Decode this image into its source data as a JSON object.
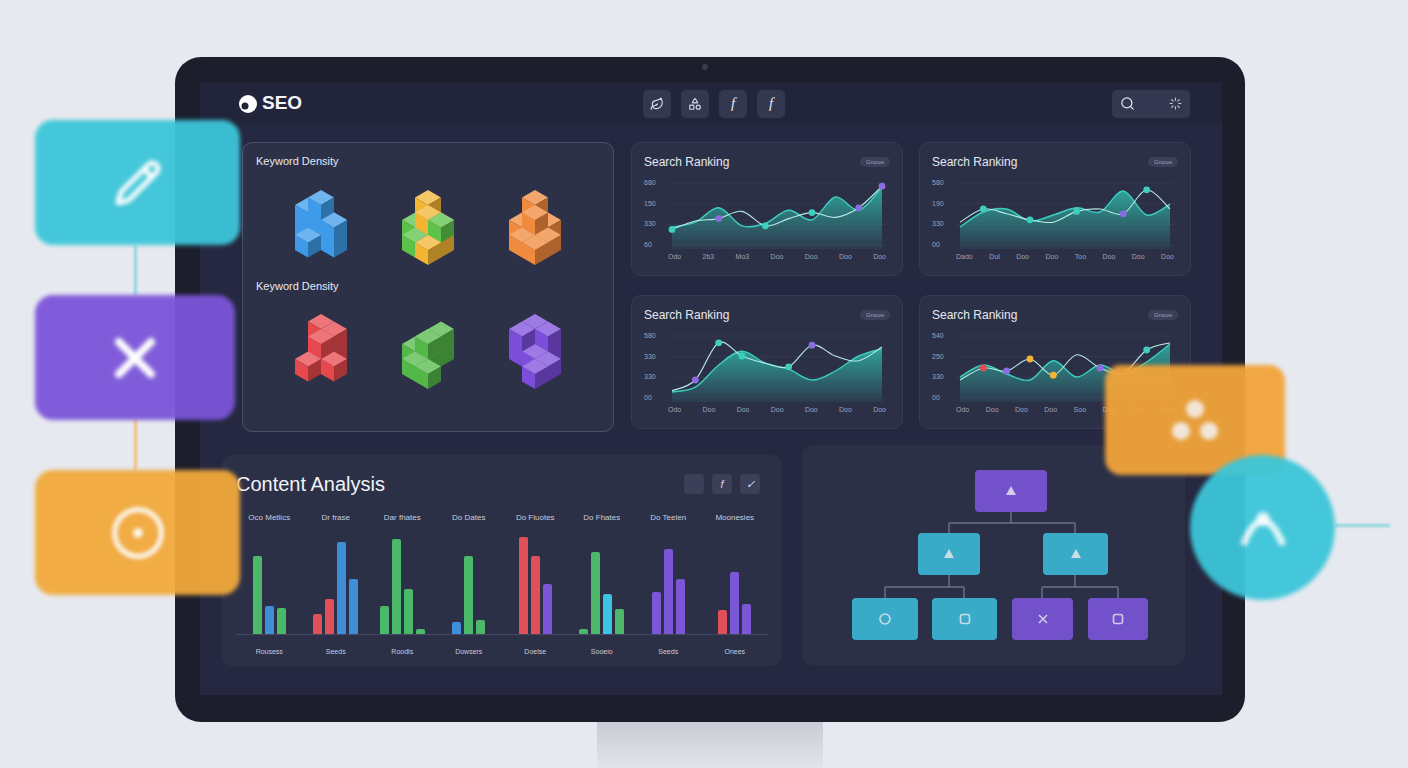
{
  "header": {
    "logo": "SEO",
    "toolbar": [
      "f",
      "f"
    ]
  },
  "keyword_panels": [
    {
      "title": "Keyword Density",
      "groups": [
        {
          "colors": [
            "#3d9be9"
          ]
        },
        {
          "colors": [
            "#5cc24a",
            "#f3b433"
          ]
        },
        {
          "colors": [
            "#f08a3c"
          ]
        }
      ]
    },
    {
      "title": "Keyword Density",
      "groups": [
        {
          "colors": [
            "#e5484d"
          ]
        },
        {
          "colors": [
            "#54b848"
          ]
        },
        {
          "colors": [
            "#7c4ddb"
          ]
        }
      ]
    }
  ],
  "charts": [
    {
      "title": "Search Ranking",
      "badge": "Gnoue",
      "ticks": [
        "680",
        "150",
        "330",
        "60"
      ],
      "x_labels": [
        "Odo",
        "2b3",
        "Mo3",
        "Doo",
        "Doo",
        "Doo",
        "Doo"
      ],
      "area": [
        30,
        38,
        62,
        32,
        36,
        58,
        42,
        80,
        58,
        96
      ],
      "line": [
        26,
        40,
        44,
        56,
        32,
        44,
        54,
        46,
        62,
        98
      ],
      "markers": [
        {
          "i": 0,
          "color": "#3ccfc0"
        },
        {
          "i": 2,
          "color": "#8b6be0"
        },
        {
          "i": 4,
          "color": "#3ccfc0"
        },
        {
          "i": 6,
          "color": "#3ccfc0"
        },
        {
          "i": 8,
          "color": "#8b6be0"
        },
        {
          "i": 9,
          "color": "#8b6be0"
        }
      ]
    },
    {
      "title": "Search Ranking",
      "badge": "Gnoue",
      "ticks": [
        "580",
        "190",
        "330",
        "00"
      ],
      "x_labels": [
        "Dado",
        "Dul",
        "Doo",
        "Doo",
        "Too",
        "Doo",
        "Doo",
        "Doo"
      ],
      "area": [
        30,
        55,
        60,
        40,
        50,
        62,
        55,
        90,
        50,
        68
      ],
      "line": [
        38,
        60,
        52,
        42,
        38,
        56,
        60,
        52,
        92,
        60
      ],
      "markers": [
        {
          "i": 1,
          "color": "#3ccfc0"
        },
        {
          "i": 3,
          "color": "#3ccfc0"
        },
        {
          "i": 5,
          "color": "#3ccfc0"
        },
        {
          "i": 7,
          "color": "#8b6be0"
        },
        {
          "i": 8,
          "color": "#3ccfc0"
        }
      ]
    },
    {
      "title": "Search Ranking",
      "badge": "Gnoue",
      "ticks": [
        "580",
        "330",
        "330",
        "00"
      ],
      "x_labels": [
        "Odo",
        "Doo",
        "Doo",
        "Doo",
        "Doo",
        "Doo",
        "Doo"
      ],
      "area": [
        10,
        18,
        55,
        78,
        58,
        48,
        30,
        45,
        70,
        82
      ],
      "line": [
        12,
        30,
        92,
        70,
        58,
        52,
        88,
        70,
        62,
        85
      ],
      "markers": [
        {
          "i": 1,
          "color": "#8b6be0"
        },
        {
          "i": 2,
          "color": "#3ccfc0"
        },
        {
          "i": 3,
          "color": "#3ccfc0"
        },
        {
          "i": 5,
          "color": "#3ccfc0"
        },
        {
          "i": 6,
          "color": "#8b6be0"
        }
      ]
    },
    {
      "title": "Search Ranking",
      "badge": "Gnoue",
      "ticks": [
        "540",
        "250",
        "330",
        "00"
      ],
      "x_labels": [
        "Odo",
        "Doo",
        "Doo",
        "Doo",
        "Soo",
        "Doo",
        "Doo",
        "Doo"
      ],
      "area": [
        35,
        55,
        40,
        30,
        62,
        35,
        55,
        40,
        60,
        90
      ],
      "line": [
        30,
        50,
        45,
        65,
        38,
        72,
        50,
        42,
        80,
        92
      ],
      "markers": [
        {
          "i": 1,
          "color": "#e5484d"
        },
        {
          "i": 2,
          "color": "#8b6be0"
        },
        {
          "i": 3,
          "color": "#f3b433"
        },
        {
          "i": 4,
          "color": "#f3b433"
        },
        {
          "i": 6,
          "color": "#8b6be0"
        },
        {
          "i": 8,
          "color": "#3ccfc0"
        }
      ]
    }
  ],
  "content_analysis": {
    "title": "Content Analysis",
    "actions": [
      "f",
      "✓"
    ],
    "groups": [
      {
        "header": "Oco Metlics",
        "label": "Rousess",
        "bars": [
          {
            "value": 78,
            "color": "#4bb86a"
          },
          {
            "value": 28,
            "color": "#3f8fd8"
          },
          {
            "value": 26,
            "color": "#4bb86a"
          }
        ]
      },
      {
        "header": "Dr frase",
        "label": "Seeds",
        "bars": [
          {
            "value": 20,
            "color": "#e0505a"
          },
          {
            "value": 35,
            "color": "#e0505a"
          },
          {
            "value": 92,
            "color": "#3f8fd8"
          },
          {
            "value": 55,
            "color": "#3f8fd8"
          }
        ]
      },
      {
        "header": "Dar fhates",
        "label": "Roodls",
        "bars": [
          {
            "value": 28,
            "color": "#4bb86a"
          },
          {
            "value": 95,
            "color": "#4bb86a"
          },
          {
            "value": 45,
            "color": "#4bb86a"
          },
          {
            "value": 5,
            "color": "#4bb86a"
          }
        ]
      },
      {
        "header": "Do Dates",
        "label": "Dowsers",
        "bars": [
          {
            "value": 12,
            "color": "#3f8fd8"
          },
          {
            "value": 78,
            "color": "#4bb86a"
          },
          {
            "value": 14,
            "color": "#4bb86a"
          }
        ]
      },
      {
        "header": "Do Fluotes",
        "label": "Doelse",
        "bars": [
          {
            "value": 97,
            "color": "#e0505a"
          },
          {
            "value": 78,
            "color": "#e0505a"
          },
          {
            "value": 50,
            "color": "#7b56d6"
          }
        ]
      },
      {
        "header": "Do Fhates",
        "label": "Sooeio",
        "bars": [
          {
            "value": 5,
            "color": "#4bb86a"
          },
          {
            "value": 82,
            "color": "#4bb86a"
          },
          {
            "value": 40,
            "color": "#3cc3e0"
          },
          {
            "value": 25,
            "color": "#4bb86a"
          }
        ]
      },
      {
        "header": "Do Teelen",
        "label": "Seeds",
        "bars": [
          {
            "value": 42,
            "color": "#7b56d6"
          },
          {
            "value": 85,
            "color": "#7b56d6"
          },
          {
            "value": 55,
            "color": "#7b56d6"
          }
        ]
      },
      {
        "header": "Moonesies",
        "label": "Onees",
        "bars": [
          {
            "value": 24,
            "color": "#e0505a"
          },
          {
            "value": 62,
            "color": "#7b56d6"
          },
          {
            "value": 30,
            "color": "#7b56d6"
          }
        ]
      }
    ]
  },
  "tree": {
    "nodes": [
      {
        "color": "#7b55d9"
      },
      {
        "color": "#3cb8d8"
      },
      {
        "color": "#3cb8d8"
      },
      {
        "color": "#3cb8d8"
      },
      {
        "color": "#3cb8d8"
      },
      {
        "color": "#7b55d9"
      },
      {
        "color": "#7b55d9"
      }
    ]
  },
  "floating_cards": [
    {
      "color": "#3cc6d9"
    },
    {
      "color": "#7b55d9"
    },
    {
      "color": "#f2a93b"
    },
    {
      "color": "#f2a43a"
    },
    {
      "color": "#3cc6d9"
    }
  ]
}
